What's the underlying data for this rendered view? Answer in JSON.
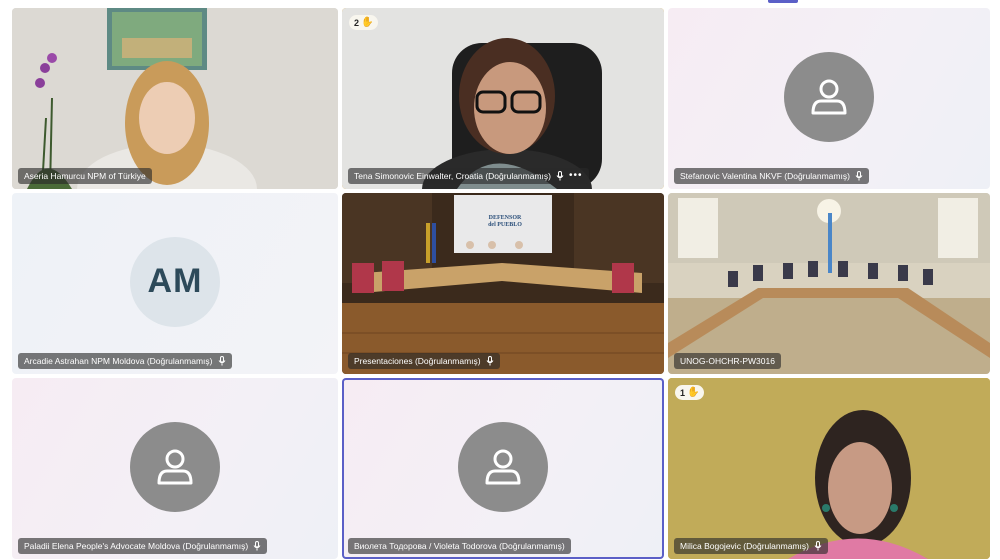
{
  "participants": [
    {
      "name": "Aseria Hamurcu NPM of Türkiye",
      "type": "video",
      "mic": false
    },
    {
      "name": "Tena Simonovic Einwalter, Croatia (Doğrulanmamış)",
      "type": "video",
      "mic": true,
      "more": true,
      "hand_raised": "2",
      "speaking": true
    },
    {
      "name": "Stefanovic Valentina NKVF (Doğrulanmamış)",
      "type": "avatar",
      "mic": true
    },
    {
      "name": "Arcadie Astrahan NPM Moldova (Doğrulanmamış)",
      "type": "initials",
      "initials": "AM",
      "mic": true
    },
    {
      "name": "Presentaciones (Doğrulanmamış)",
      "type": "video",
      "mic": true
    },
    {
      "name": "UNOG-OHCHR-PW3016",
      "type": "video",
      "mic": false
    },
    {
      "name": "Paladii Elena People's Advocate Moldova (Doğrulanmamış)",
      "type": "avatar",
      "mic": true
    },
    {
      "name": "Виолета Тодорова / Violeta Todorova (Doğrulanmamış)",
      "type": "avatar",
      "mic": false,
      "selected": true
    },
    {
      "name": "Milica Bogojevic (Doğrulanmamış)",
      "type": "video",
      "mic": true,
      "hand_raised": "1",
      "speaking": true
    }
  ],
  "room_sign": {
    "line1": "DEFENSOR",
    "line2": "del PUEBLO"
  },
  "colors": {
    "speaking_border": "#e6a417",
    "selected_border": "#5b5fc7",
    "avatar_gray": "#8c8c8c"
  }
}
